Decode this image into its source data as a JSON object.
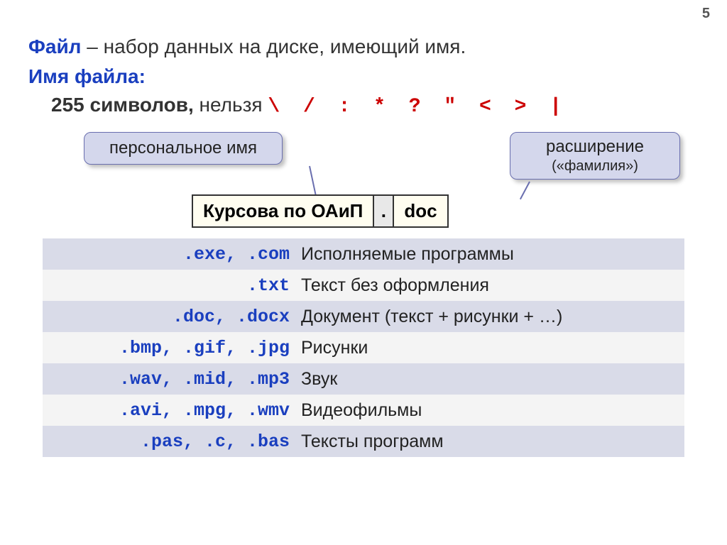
{
  "page_number": "5",
  "def": {
    "term": "Файл",
    "dash": " – ",
    "rest": "набор данных на диске, имеющий имя."
  },
  "name_label": "Имя файла:",
  "rule": {
    "limit": "255 символов,",
    "word": " нельзя ",
    "chars": "\\ / : * ? \" < > |"
  },
  "callout_left": "персональное имя",
  "callout_right_line1": "расширение",
  "callout_right_line2": "(«фамилия»)",
  "filename": {
    "name": "Курсова по ОАиП",
    "dot": ".",
    "ext": "doc"
  },
  "rows": [
    {
      "ext": ".exe, .com",
      "desc": "Исполняемые программы"
    },
    {
      "ext": ".txt",
      "desc": "Текст без оформления"
    },
    {
      "ext": ".doc, .docx",
      "desc": "Документ (текст + рисунки + …)"
    },
    {
      "ext": ".bmp, .gif, .jpg",
      "desc": "Рисунки"
    },
    {
      "ext": ".wav, .mid, .mp3",
      "desc": "Звук"
    },
    {
      "ext": ".avi, .mpg, .wmv",
      "desc": "Видеофильмы"
    },
    {
      "ext": ".pas, .c, .bas",
      "desc": "Тексты программ"
    }
  ]
}
